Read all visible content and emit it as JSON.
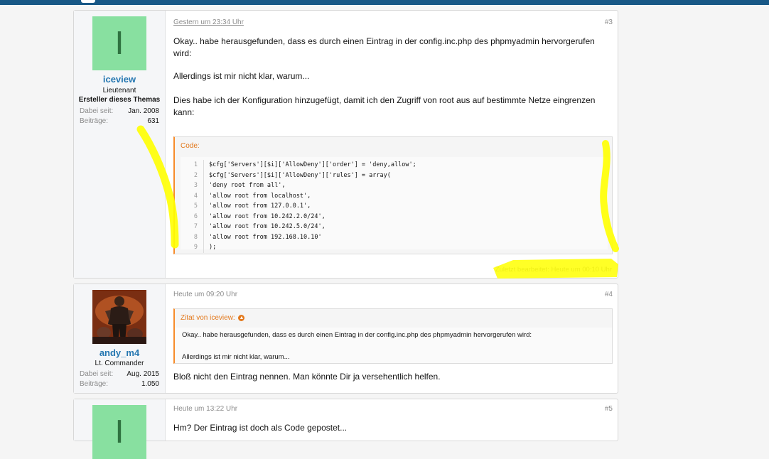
{
  "posts": [
    {
      "user": {
        "avatar_letter": "I",
        "name": "iceview",
        "title": "Lieutenant",
        "badge": "Ersteller dieses Themas",
        "joined_label": "Dabei seit:",
        "joined_value": "Jan. 2008",
        "posts_label": "Beiträge:",
        "posts_value": "631"
      },
      "date": "Gestern um 23:34 Uhr",
      "number": "#3",
      "text1": "Okay.. habe herausgefunden, dass es durch einen Eintrag in der config.inc.php des phpmyadmin hervorgerufen wird:",
      "text2": "Allerdings ist mir nicht klar, warum...",
      "text3": "Dies habe ich der Konfiguration hinzugefügt, damit ich den Zugriff von root aus auf bestimmte Netze eingrenzen kann:",
      "code_title": "Code:",
      "code": [
        {
          "n": "1",
          "t": "$cfg['Servers'][$i]['AllowDeny']['order'] = 'deny,allow';"
        },
        {
          "n": "2",
          "t": "$cfg['Servers'][$i]['AllowDeny']['rules'] = array("
        },
        {
          "n": "3",
          "t": "'deny root from all',"
        },
        {
          "n": "4",
          "t": "'allow root from localhost',"
        },
        {
          "n": "5",
          "t": "'allow root from 127.0.0.1',"
        },
        {
          "n": "6",
          "t": "'allow root from 10.242.2.0/24',"
        },
        {
          "n": "7",
          "t": "'allow root from 10.242.5.0/24',"
        },
        {
          "n": "8",
          "t": "'allow root from 192.168.10.10'"
        },
        {
          "n": "9",
          "t": ");"
        }
      ],
      "edited": "Zuletzt bearbeitet: Heute um 00:10 Uhr"
    },
    {
      "user": {
        "name": "andy_m4",
        "title": "Lt. Commander",
        "joined_label": "Dabei seit:",
        "joined_value": "Aug. 2015",
        "posts_label": "Beiträge:",
        "posts_value": "1.050"
      },
      "date": "Heute um 09:20 Uhr",
      "number": "#4",
      "quote_title": "Zitat von iceview:",
      "quote_line1": "Okay.. habe herausgefunden, dass es durch einen Eintrag in der config.inc.php des phpmyadmin hervorgerufen wird:",
      "quote_line2": "Allerdings ist mir nicht klar, warum...",
      "text": "Bloß nicht den Eintrag nennen. Man könnte Dir ja versehentlich helfen."
    },
    {
      "user": {
        "avatar_letter": "I"
      },
      "date": "Heute um 13:22 Uhr",
      "number": "#5",
      "text": "Hm? Der Eintrag ist doch als Code gepostet..."
    }
  ],
  "colors": {
    "highlight": "#ffff00",
    "accent": "#f78c2b",
    "username": "#2577b1",
    "topbar": "#185886"
  },
  "icons": {
    "quote_jump": "arrow-up-circle-icon"
  }
}
